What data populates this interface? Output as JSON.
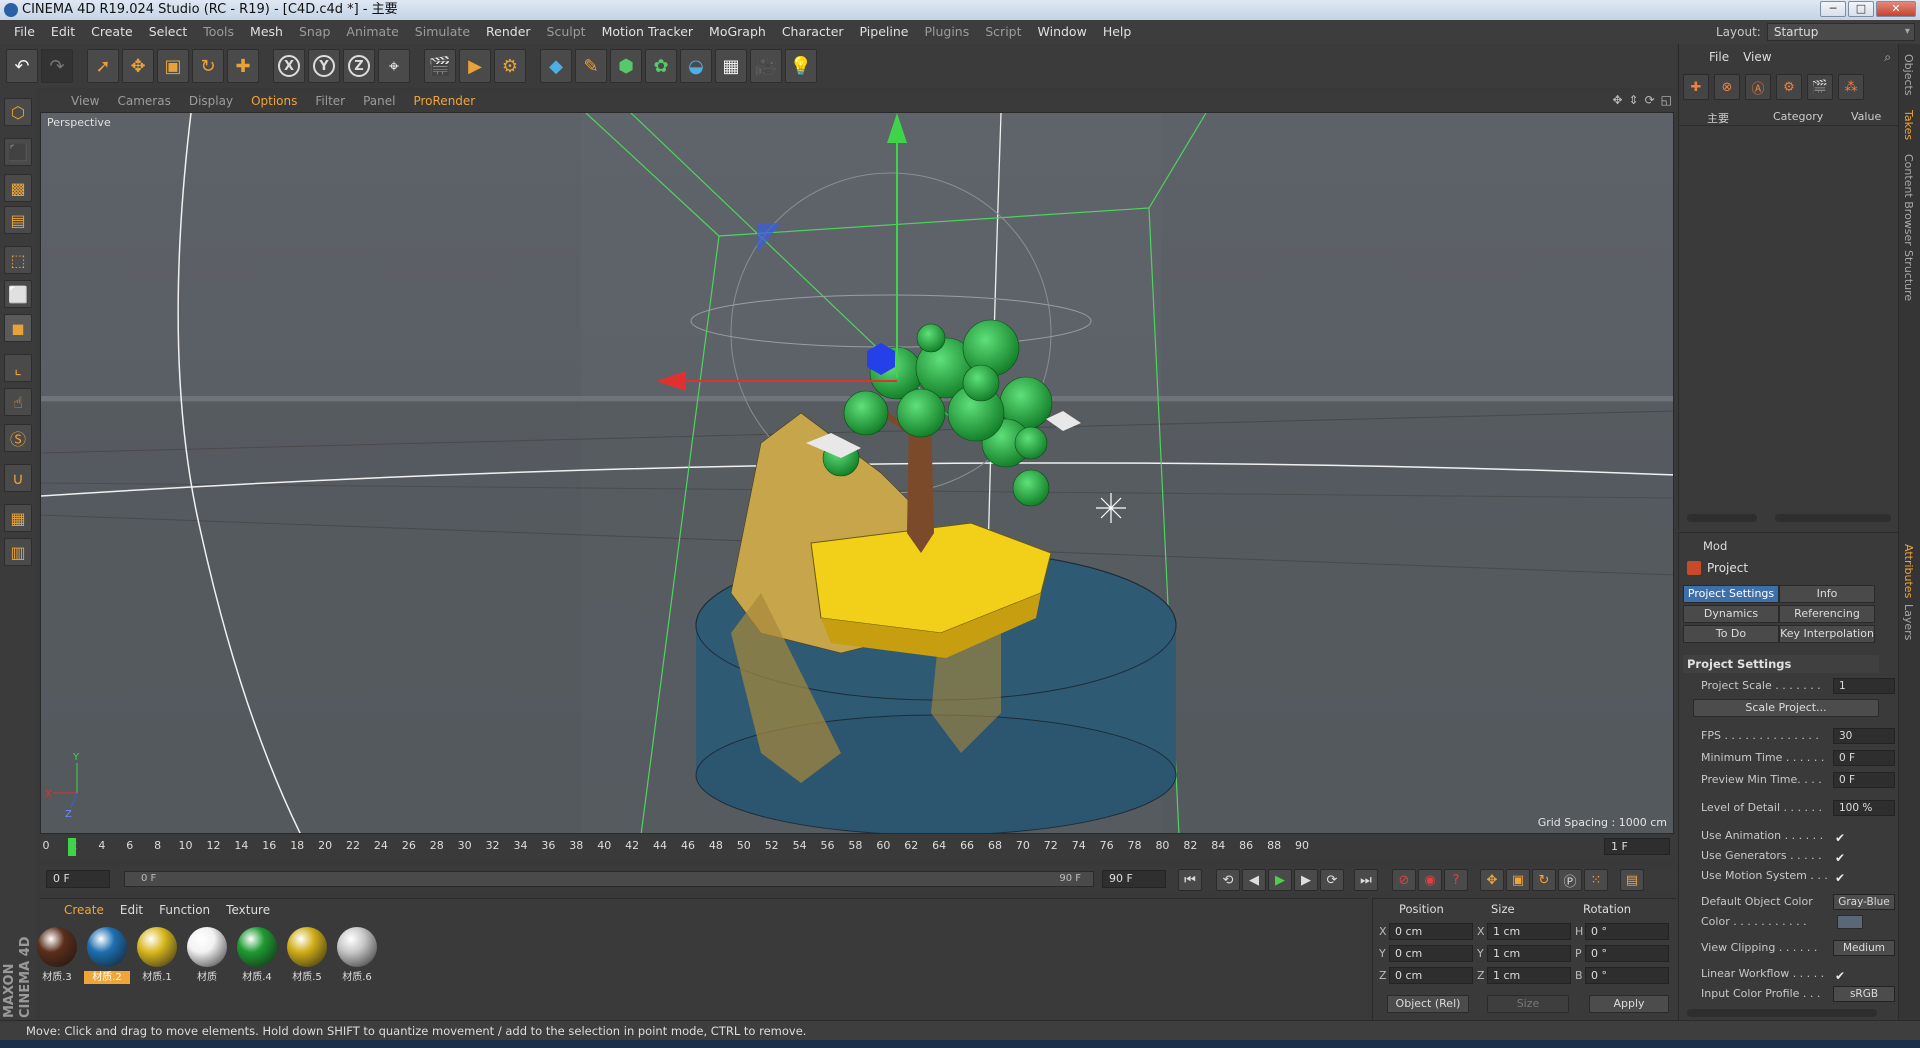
{
  "window": {
    "title": "CINEMA 4D R19.024 Studio (RC - R19) - [C4D.c4d *] - 主要",
    "minimize": "─",
    "maximize": "□",
    "close": "✕"
  },
  "menubar": {
    "items": [
      "File",
      "Edit",
      "Create",
      "Select",
      "Tools",
      "Mesh",
      "Snap",
      "Animate",
      "Simulate",
      "Render",
      "Sculpt",
      "Motion Tracker",
      "MoGraph",
      "Character",
      "Pipeline",
      "Plugins",
      "Script",
      "Window",
      "Help"
    ],
    "layout_label": "Layout:",
    "layout_value": "Startup"
  },
  "viewport": {
    "menu": [
      "View",
      "Cameras",
      "Display",
      "Options",
      "Filter",
      "Panel",
      "ProRender"
    ],
    "label": "Perspective",
    "grid_spacing": "Grid Spacing : 1000 cm",
    "axis_y": "Y",
    "axis_x": "X",
    "axis_z": "Z"
  },
  "timeline": {
    "ticks": [
      "0",
      "2",
      "4",
      "6",
      "8",
      "10",
      "12",
      "14",
      "16",
      "18",
      "20",
      "22",
      "24",
      "26",
      "28",
      "30",
      "32",
      "34",
      "36",
      "38",
      "40",
      "42",
      "44",
      "46",
      "48",
      "50",
      "52",
      "54",
      "56",
      "58",
      "60",
      "62",
      "64",
      "66",
      "68",
      "70",
      "72",
      "74",
      "76",
      "78",
      "80",
      "82",
      "84",
      "86",
      "88",
      "90"
    ],
    "current_frame_field": "1 F",
    "start_field": "0 F",
    "slider_start": "0 F",
    "slider_end": "90 F",
    "end_field": "90 F"
  },
  "materials": {
    "menu": [
      "Create",
      "Edit",
      "Function",
      "Texture"
    ],
    "items": [
      {
        "name": "材质.3",
        "color": "#5a2e1a",
        "selected": false
      },
      {
        "name": "材质.2",
        "color": "#1e6fb0",
        "selected": true
      },
      {
        "name": "材质.1",
        "color": "#d9b820",
        "selected": false
      },
      {
        "name": "材质",
        "color": "#f2f2f2",
        "selected": false
      },
      {
        "name": "材质.4",
        "color": "#1e9a32",
        "selected": false
      },
      {
        "name": "材质.5",
        "color": "#cfae18",
        "selected": false
      },
      {
        "name": "材质.6",
        "color": "#c8c8c8",
        "selected": false
      }
    ]
  },
  "coords": {
    "position_header": "Position",
    "size_header": "Size",
    "rotation_header": "Rotation",
    "pos_labels": [
      "X",
      "Y",
      "Z"
    ],
    "size_labels": [
      "X",
      "Y",
      "Z"
    ],
    "rot_labels": [
      "H",
      "P",
      "B"
    ],
    "pos_values": [
      "0 cm",
      "0 cm",
      "0 cm"
    ],
    "size_values": [
      "1 cm",
      "1 cm",
      "1 cm"
    ],
    "rot_values": [
      "0 °",
      "0 °",
      "0 °"
    ],
    "mode_select": "Object (Rel)",
    "size_select": "Size",
    "apply": "Apply"
  },
  "status": {
    "text": "Move: Click and drag to move elements. Hold down SHIFT to quantize movement / add to the selection in point mode, CTRL to remove."
  },
  "brand": {
    "logo": "MAXON CINEMA 4D"
  },
  "objects": {
    "menu": [
      "File",
      "View"
    ],
    "tree_item": "主要",
    "col_category": "Category",
    "col_value": "Value"
  },
  "attributes": {
    "menu": "Mod",
    "title": "Project",
    "tabs": [
      "Project Settings",
      "Info",
      "Dynamics",
      "Referencing",
      "To Do",
      "Key Interpolation"
    ],
    "section": "Project Settings",
    "rows": {
      "project_scale": {
        "label": "Project Scale . . . . . . .",
        "value": "1"
      },
      "scale_project": "Scale Project...",
      "fps": {
        "label": "FPS . . . . . . . . . . . . . .",
        "value": "30"
      },
      "min_time": {
        "label": "Minimum Time . . . . . .",
        "value": "0 F"
      },
      "preview_min": {
        "label": "Preview Min Time. . . .",
        "value": "0 F"
      },
      "lod": {
        "label": "Level of Detail . . . . . .",
        "value": "100 %"
      },
      "use_anim": {
        "label": "Use Animation . . . . . .",
        "value": "✔"
      },
      "use_gen": {
        "label": "Use Generators . . . . .",
        "value": "✔"
      },
      "use_motion": {
        "label": "Use Motion System . . .",
        "value": "✔"
      },
      "default_color": {
        "label": "Default Object Color",
        "value": "Gray-Blue"
      },
      "color": {
        "label": "Color . . . . . . . . . . .",
        "value": ""
      },
      "view_clipping": {
        "label": "View Clipping . . . . . .",
        "value": "Medium"
      },
      "linear_wf": {
        "label": "Linear Workflow . . . . .",
        "value": "✔"
      },
      "input_profile": {
        "label": "Input Color Profile . . .",
        "value": "sRGB"
      }
    }
  },
  "side_tabs": [
    "Objects",
    "Takes",
    "Content Browser",
    "Structure",
    "Attributes",
    "Layers"
  ],
  "colors": {
    "accent": "#f0a537",
    "active_tab": "#3e6fa8",
    "viewport_bg": "#5a5f64",
    "panel_bg": "#3a3a3a"
  }
}
